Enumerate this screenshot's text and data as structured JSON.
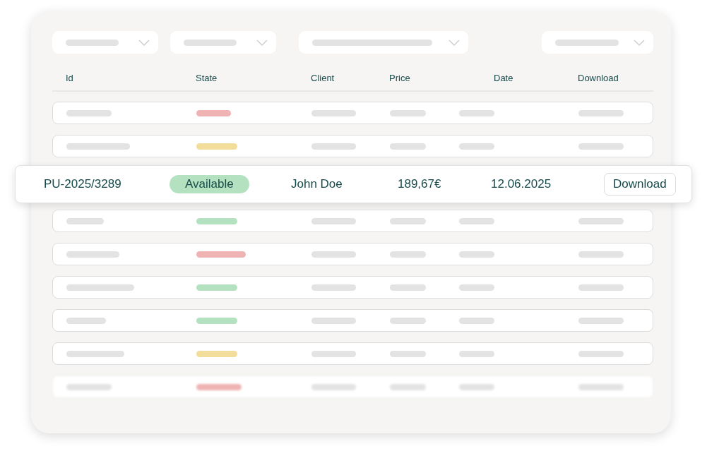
{
  "columns": [
    "Id",
    "State",
    "Client",
    "Price",
    "Date",
    "Download"
  ],
  "rows": [
    {
      "kind": "skeleton",
      "color": "#efb3b3",
      "blurred": false
    },
    {
      "kind": "skeleton",
      "color": "#f2dd9a",
      "blurred": false
    },
    {
      "kind": "detail",
      "id": "PU-2025/3289",
      "state": "Available",
      "color": "#b4e2c0",
      "client": "John Doe",
      "price": "189,67€",
      "date": "12.06.2025",
      "action": "Download"
    },
    {
      "kind": "skeleton",
      "color": "#b4e2c0",
      "blurred": false
    },
    {
      "kind": "skeleton",
      "color": "#efb3b3",
      "blurred": false
    },
    {
      "kind": "skeleton",
      "color": "#b4e2c0",
      "blurred": false
    },
    {
      "kind": "skeleton",
      "color": "#b4e2c0",
      "blurred": false
    },
    {
      "kind": "skeleton",
      "color": "#f2dd9a",
      "blurred": false
    },
    {
      "kind": "skeleton",
      "color": "#efb3b3",
      "blurred": true
    }
  ]
}
